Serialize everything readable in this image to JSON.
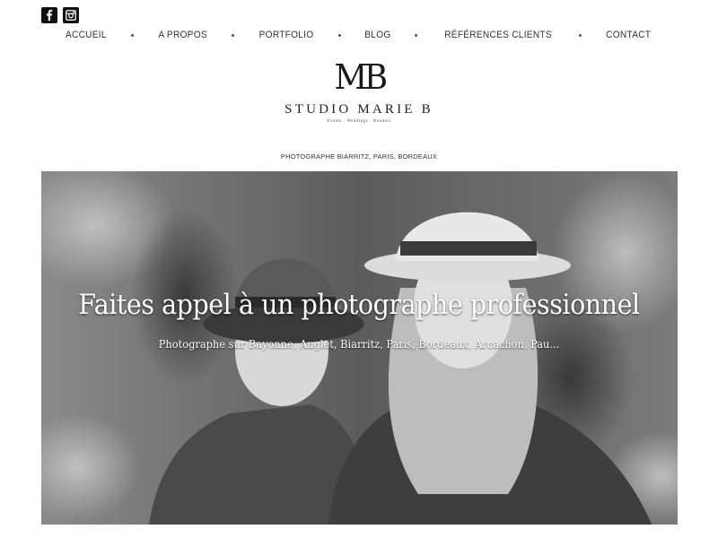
{
  "social": {
    "facebook_icon": "facebook-icon",
    "instagram_icon": "instagram-icon"
  },
  "nav": {
    "items": [
      "ACCUEIL",
      "A PROPOS",
      "PORTFOLIO",
      "BLOG",
      "RÉFÉRENCES CLIENTS",
      "CONTACT"
    ]
  },
  "logo": {
    "mark": "MB",
    "name": "STUDIO MARIE B",
    "sub": "Events · Weddings · Boudoir"
  },
  "tagline": "PHOTOGRAPHE BIARRITZ, PARIS, BORDEAUX",
  "hero": {
    "title": "Faites appel à un photographe professionnel",
    "subtitle": "Photographe sur Bayonne, Anglet, Biarritz, Paris, Bordeaux, Arcachon, Pau..."
  },
  "colors": {
    "background": "#ffffff",
    "text": "#222222",
    "icon_bg": "#111111"
  }
}
